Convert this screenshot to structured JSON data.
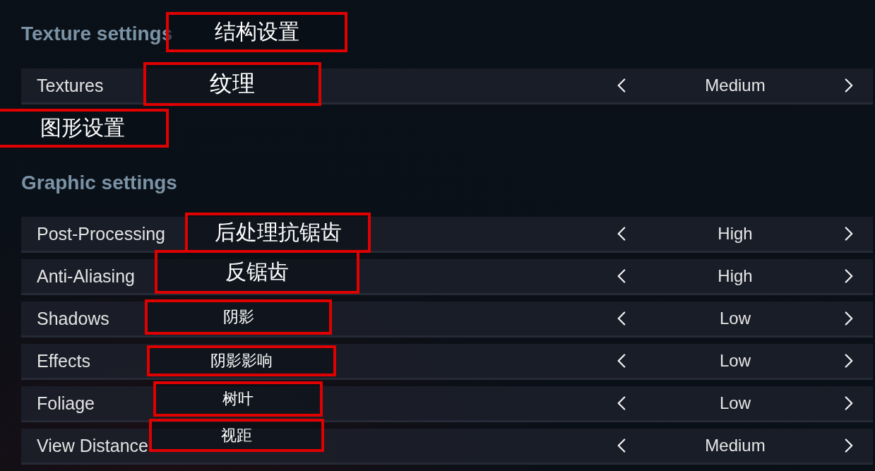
{
  "sections": [
    {
      "heading": "Texture settings",
      "annotation": "结构设置",
      "rows": [
        {
          "label": "Textures",
          "annotation": "纹理",
          "value": "Medium"
        }
      ]
    },
    {
      "heading": "Graphic settings",
      "annotation": "图形设置",
      "rows": [
        {
          "label": "Post-Processing",
          "annotation": "后处理抗锯齿",
          "value": "High"
        },
        {
          "label": "Anti-Aliasing",
          "annotation": "反锯齿",
          "value": "High"
        },
        {
          "label": "Shadows",
          "annotation": "阴影",
          "value": "Low"
        },
        {
          "label": "Effects",
          "annotation": "阴影影响",
          "value": "Low"
        },
        {
          "label": "Foliage",
          "annotation": "树叶",
          "value": "Low"
        },
        {
          "label": "View Distance",
          "annotation": "视距",
          "value": "Medium"
        }
      ]
    }
  ]
}
